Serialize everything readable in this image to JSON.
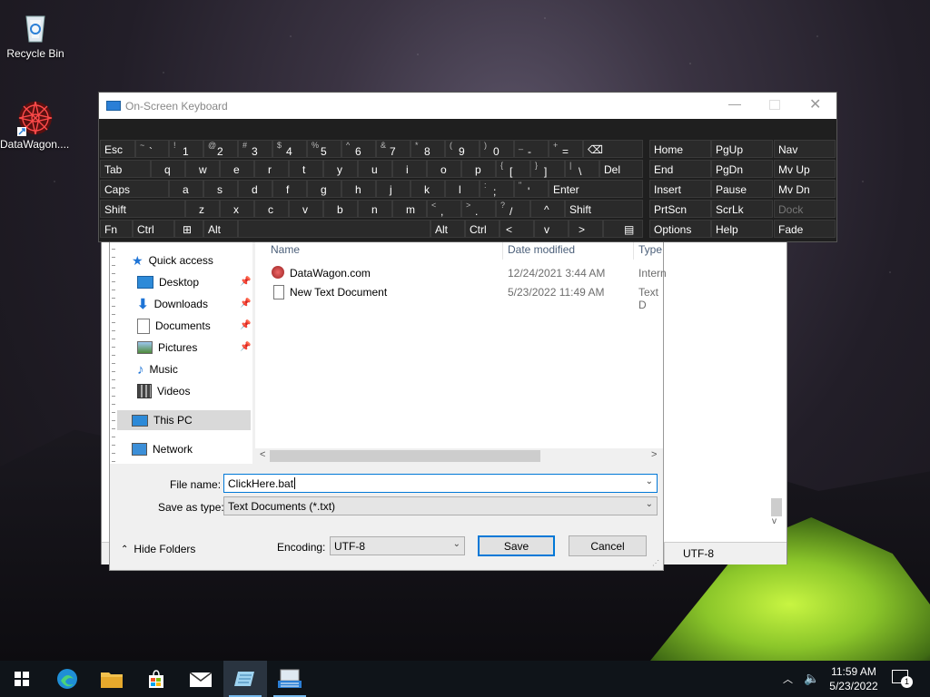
{
  "desktop": {
    "icons": [
      {
        "label": "Recycle Bin",
        "icon": "recycle-bin-icon"
      },
      {
        "label": "DataWagon....",
        "icon": "datawagon-shortcut-icon"
      }
    ]
  },
  "osk": {
    "title": "On-Screen Keyboard",
    "rows": [
      [
        {
          "main": "Esc"
        },
        {
          "shift": "~",
          "main": "`"
        },
        {
          "shift": "!",
          "main": "1"
        },
        {
          "shift": "@",
          "main": "2"
        },
        {
          "shift": "#",
          "main": "3"
        },
        {
          "shift": "$",
          "main": "4"
        },
        {
          "shift": "%",
          "main": "5"
        },
        {
          "shift": "^",
          "main": "6"
        },
        {
          "shift": "&",
          "main": "7"
        },
        {
          "shift": "*",
          "main": "8"
        },
        {
          "shift": "(",
          "main": "9"
        },
        {
          "shift": ")",
          "main": "0"
        },
        {
          "shift": "_",
          "main": "-"
        },
        {
          "shift": "+",
          "main": "="
        },
        {
          "main": "⌫"
        }
      ],
      [
        {
          "main": "Tab"
        },
        {
          "main": "q"
        },
        {
          "main": "w"
        },
        {
          "main": "e"
        },
        {
          "main": "r"
        },
        {
          "main": "t"
        },
        {
          "main": "y"
        },
        {
          "main": "u"
        },
        {
          "main": "i"
        },
        {
          "main": "o"
        },
        {
          "main": "p"
        },
        {
          "shift": "{",
          "main": "["
        },
        {
          "shift": "}",
          "main": "]"
        },
        {
          "shift": "|",
          "main": "\\"
        },
        {
          "main": "Del"
        }
      ],
      [
        {
          "main": "Caps"
        },
        {
          "main": "a"
        },
        {
          "main": "s"
        },
        {
          "main": "d"
        },
        {
          "main": "f"
        },
        {
          "main": "g"
        },
        {
          "main": "h"
        },
        {
          "main": "j"
        },
        {
          "main": "k"
        },
        {
          "main": "l"
        },
        {
          "shift": ":",
          "main": ";"
        },
        {
          "shift": "\"",
          "main": "'"
        },
        {
          "main": "Enter"
        }
      ],
      [
        {
          "main": "Shift"
        },
        {
          "main": "z"
        },
        {
          "main": "x"
        },
        {
          "main": "c"
        },
        {
          "main": "v"
        },
        {
          "main": "b"
        },
        {
          "main": "n"
        },
        {
          "main": "m"
        },
        {
          "shift": "<",
          "main": ","
        },
        {
          "shift": ">",
          "main": "."
        },
        {
          "shift": "?",
          "main": "/"
        },
        {
          "main": "^"
        },
        {
          "main": "Shift"
        }
      ],
      [
        {
          "main": "Fn"
        },
        {
          "main": "Ctrl"
        },
        {
          "main": "⊞"
        },
        {
          "main": "Alt"
        },
        {
          "main": ""
        },
        {
          "main": "Alt"
        },
        {
          "main": "Ctrl"
        },
        {
          "main": "<"
        },
        {
          "main": "v"
        },
        {
          "main": ">"
        },
        {
          "main": "▤"
        }
      ]
    ],
    "nav_keys": [
      [
        "Home",
        "PgUp",
        "Nav"
      ],
      [
        "End",
        "PgDn",
        "Mv Up"
      ],
      [
        "Insert",
        "Pause",
        "Mv Dn"
      ],
      [
        "PrtScn",
        "ScrLk",
        "Dock"
      ],
      [
        "Options",
        "Help",
        "Fade"
      ]
    ]
  },
  "dialog": {
    "nav": [
      {
        "label": "Quick access",
        "icon": "star-icon",
        "pinned": false
      },
      {
        "label": "Desktop",
        "icon": "desktop-folder-icon",
        "pinned": true
      },
      {
        "label": "Downloads",
        "icon": "downloads-icon",
        "pinned": true
      },
      {
        "label": "Documents",
        "icon": "documents-icon",
        "pinned": true
      },
      {
        "label": "Pictures",
        "icon": "pictures-icon",
        "pinned": true
      },
      {
        "label": "Music",
        "icon": "music-icon",
        "pinned": false
      },
      {
        "label": "Videos",
        "icon": "videos-icon",
        "pinned": false
      },
      {
        "label": "This PC",
        "icon": "this-pc-icon",
        "pinned": false
      },
      {
        "label": "Network",
        "icon": "network-icon",
        "pinned": false
      }
    ],
    "columns": {
      "name": "Name",
      "date": "Date modified",
      "type": "Type"
    },
    "files": [
      {
        "name": "DataWagon.com",
        "date": "12/24/2021 3:44 AM",
        "type": "Intern",
        "icon": "internet-shortcut-icon"
      },
      {
        "name": "New Text Document",
        "date": "5/23/2022 11:49 AM",
        "type": "Text D",
        "icon": "text-file-icon"
      }
    ],
    "file_name_label": "File name:",
    "file_name_value": "ClickHere.bat",
    "save_type_label": "Save as type:",
    "save_type_value": "Text Documents (*.txt)",
    "hide_folders": "Hide Folders",
    "encoding_label": "Encoding:",
    "encoding_value": "UTF-8",
    "save": "Save",
    "cancel": "Cancel"
  },
  "notepad": {
    "status_encoding": "UTF-8"
  },
  "tray": {
    "time": "11:59 AM",
    "date": "5/23/2022",
    "notifications": "1"
  }
}
